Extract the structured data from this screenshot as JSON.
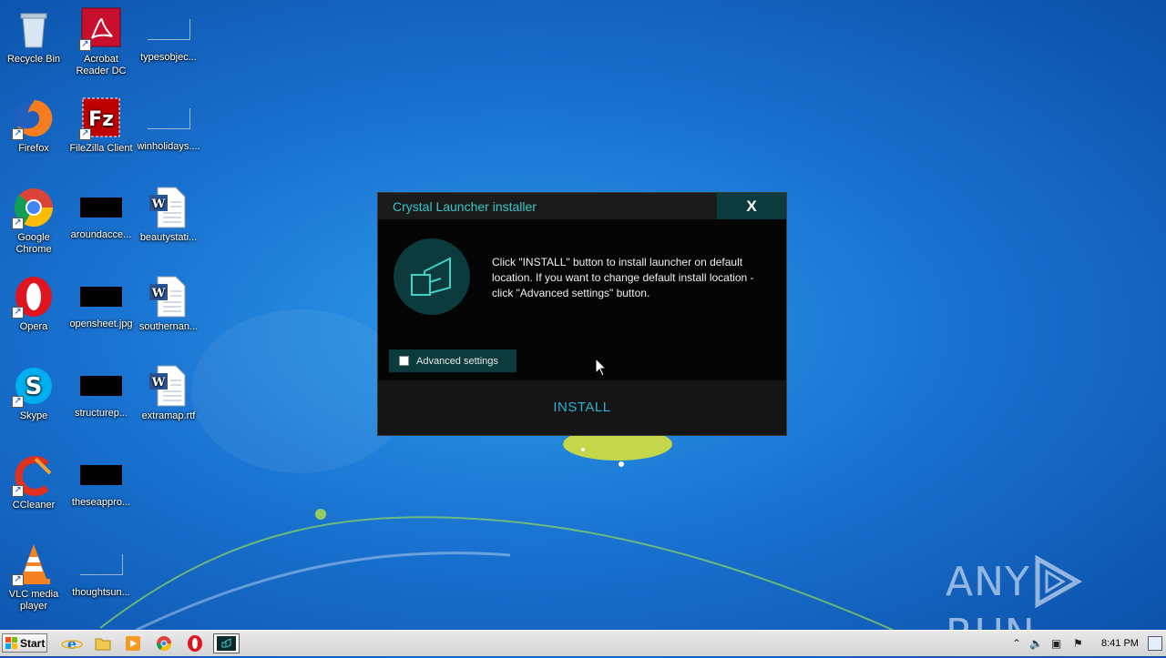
{
  "desktop": {
    "icons": [
      {
        "label": "Recycle Bin",
        "icon": "recycle-bin-icon"
      },
      {
        "label": "Acrobat Reader DC",
        "icon": "acrobat-reader-icon"
      },
      {
        "label": "typesobjec...",
        "icon": "blank-file-icon"
      },
      {
        "label": "Firefox",
        "icon": "firefox-icon"
      },
      {
        "label": "FileZilla Client",
        "icon": "filezilla-icon"
      },
      {
        "label": "winholidays....",
        "icon": "blank-file-icon"
      },
      {
        "label": "Google Chrome",
        "icon": "chrome-icon"
      },
      {
        "label": "aroundacce...",
        "icon": "black-thumbnail-icon"
      },
      {
        "label": "beautystati...",
        "icon": "word-document-icon"
      },
      {
        "label": "Opera",
        "icon": "opera-icon"
      },
      {
        "label": "opensheet.jpg",
        "icon": "black-thumbnail-icon"
      },
      {
        "label": "southernan...",
        "icon": "word-document-icon"
      },
      {
        "label": "Skype",
        "icon": "skype-icon"
      },
      {
        "label": "structurep...",
        "icon": "black-thumbnail-icon"
      },
      {
        "label": "extramap.rtf",
        "icon": "word-document-icon"
      },
      {
        "label": "CCleaner",
        "icon": "ccleaner-icon"
      },
      {
        "label": "theseappro...",
        "icon": "black-thumbnail-icon"
      },
      {
        "label": "VLC media player",
        "icon": "vlc-icon"
      },
      {
        "label": "thoughtsun...",
        "icon": "blank-file-icon"
      }
    ]
  },
  "dialog": {
    "title": "Crystal Launcher installer",
    "close_label": "X",
    "message": "Click \"INSTALL\" button to install launcher on default location. If you want to change default install location - click \"Advanced settings\" button.",
    "advanced_settings_label": "Advanced settings",
    "advanced_settings_checked": false,
    "install_label": "INSTALL",
    "accent_color": "#39c6c9"
  },
  "watermark": {
    "left": "ANY",
    "right": "RUN"
  },
  "taskbar": {
    "start_label": "Start",
    "pinned": [
      "internet-explorer-icon",
      "file-explorer-icon",
      "media-player-icon",
      "chrome-icon",
      "opera-icon",
      "crystal-launcher-icon"
    ],
    "clock": "8:41 PM"
  }
}
